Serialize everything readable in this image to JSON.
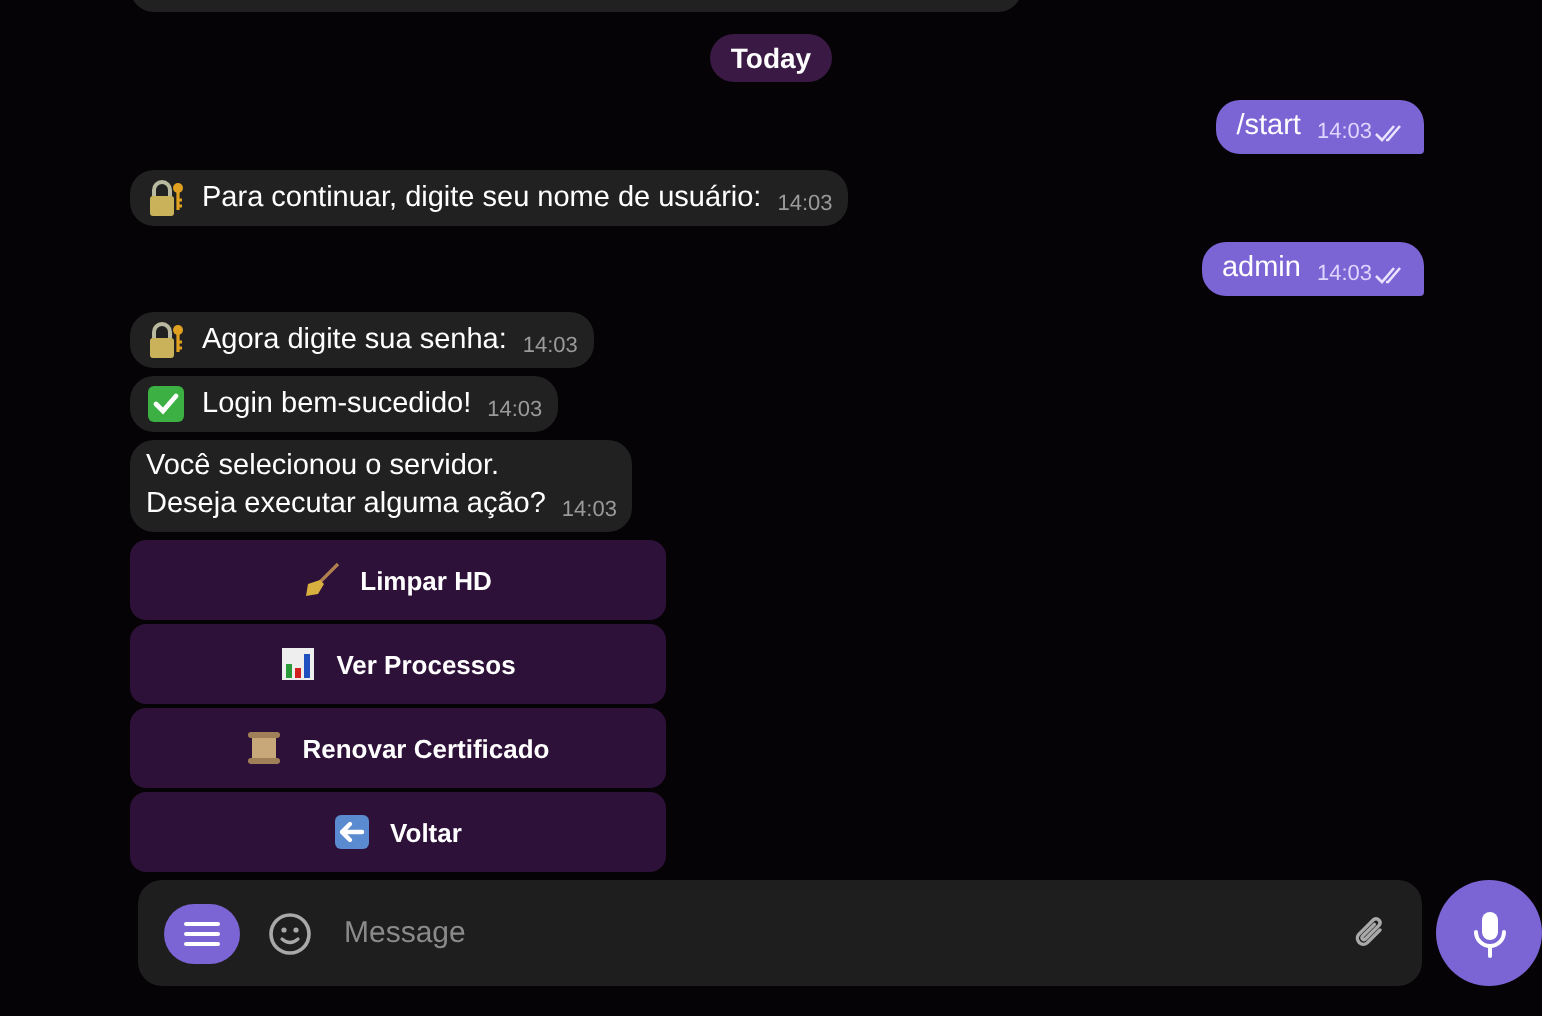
{
  "date_pill": "Today",
  "messages": [
    {
      "kind": "sent",
      "text": "/start",
      "time": "14:03",
      "read": true
    },
    {
      "kind": "received",
      "text": "Para continuar, digite seu nome de usuário:",
      "time": "14:03"
    },
    {
      "kind": "sent",
      "text": "admin",
      "time": "14:03",
      "read": true
    },
    {
      "kind": "received",
      "text": "Agora digite sua senha:",
      "time": "14:03"
    },
    {
      "kind": "received",
      "text": "Login bem-sucedido!",
      "time": "14:03"
    },
    {
      "kind": "received",
      "text": "Você selecionou o servidor.\nDeseja executar alguma ação?",
      "time": "14:03"
    }
  ],
  "keyboard": [
    {
      "label": "Limpar HD"
    },
    {
      "label": "Ver Processos"
    },
    {
      "label": "Renovar Certificado"
    },
    {
      "label": "Voltar"
    }
  ],
  "composer": {
    "placeholder": "Message"
  }
}
